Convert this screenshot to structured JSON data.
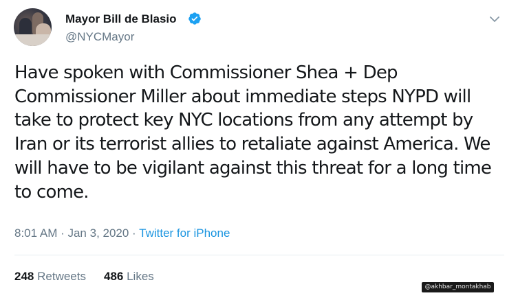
{
  "tweet": {
    "display_name": "Mayor Bill de Blasio",
    "handle": "@NYCMayor",
    "verified_icon": "verified-badge-icon",
    "more_icon": "chevron-down-icon",
    "text": "Have spoken with Commissioner Shea + Dep Commissioner Miller about immediate steps NYPD will take to protect key NYC locations from any attempt by Iran or its terrorist allies to retaliate against America. We will have to be vigilant against this threat for a long time to come.",
    "timestamp": "8:01 AM · Jan 3, 2020 · ",
    "source": "Twitter for iPhone",
    "retweets_count": "248",
    "retweets_label": "Retweets",
    "likes_count": "486",
    "likes_label": "Likes"
  },
  "watermark": "@akhbar_montakhab",
  "colors": {
    "verified_blue": "#1da1f2",
    "link_blue": "#1b95e0",
    "secondary_text": "#657786"
  }
}
